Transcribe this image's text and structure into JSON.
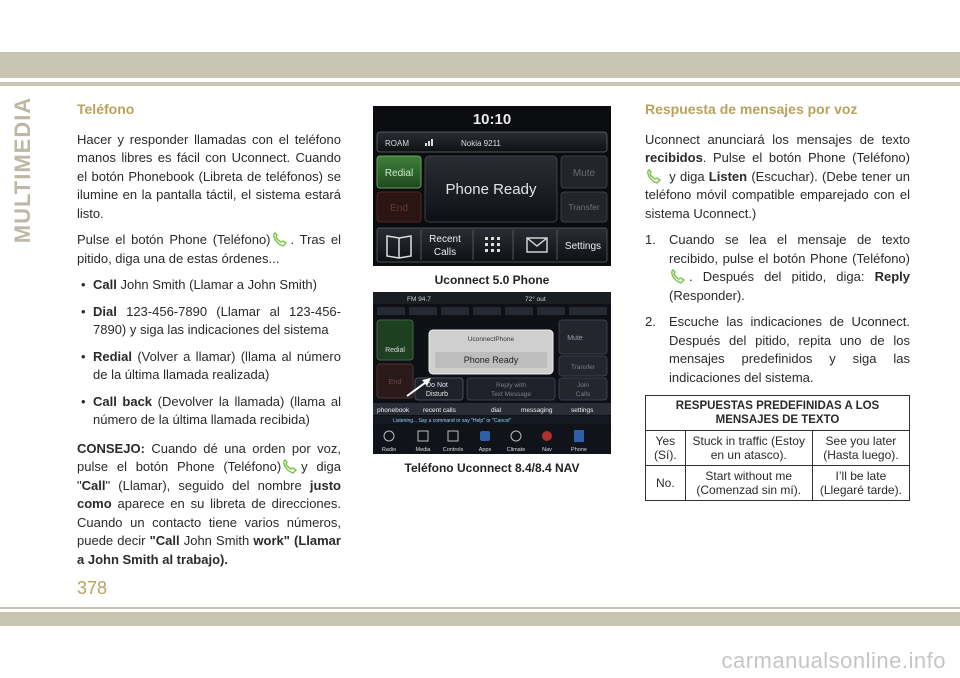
{
  "side_tab": "MULTIMEDIA",
  "left": {
    "heading": "Teléfono",
    "intro": "Hacer y responder llamadas con el teléfono manos libres es fácil con Uconnect. Cuando el botón Phonebook (Libreta de teléfonos) se ilumine en la pantalla táctil, el sistema estará listo.",
    "press_a": "Pulse el botón Phone (Teléfono)",
    "press_b": ". Tras el pitido, diga una de estas órdenes...",
    "bullets": [
      {
        "key": "Call",
        "text": "John Smith (Llamar a John Smith)"
      },
      {
        "key": "Dial",
        "text": "123-456-7890 (Llamar al 123-456-7890) y siga las indicaciones del sistema"
      },
      {
        "key": "Redial",
        "text": "(Volver a llamar) (llama al número de la última llamada realizada)"
      },
      {
        "key": "Call back",
        "text": "(Devolver la llamada) (llama al número de la última llamada recibida)"
      }
    ],
    "tip_label": "CONSEJO:",
    "tip_a": "Cuando dé una orden por voz, pulse el botón Phone (Teléfono)",
    "tip_b": "y diga \"",
    "tip_call": "Call",
    "tip_c": "\" (Llamar), seguido del nombre",
    "tip_justo": "justo como",
    "tip_d": "aparece en su libreta de direcciones. Cuando un contacto tiene varios números, puede decir",
    "tip_e": "\"Call",
    "tip_f": "John Smith",
    "tip_g": "work\" (Llamar a John Smith al trabajo)."
  },
  "screen1": {
    "time": "10:10",
    "roam": "ROAM",
    "carrier": "Nokia 9211",
    "redial": "Redial",
    "end": "End",
    "status": "Phone Ready",
    "mute": "Mute",
    "transfer": "Transfer",
    "recent1": "Recent",
    "recent2": "Calls",
    "settings": "Settings",
    "caption": "Uconnect 5.0 Phone"
  },
  "screen2": {
    "station": "FM 94.7",
    "temp": "72° out",
    "device": "UconnectPhone",
    "status": "Phone Ready",
    "redial": "Redial",
    "end": "End",
    "dnd1": "Do Not",
    "dnd2": "Disturb",
    "reply1": "Reply with",
    "reply2": "Text Message",
    "mute": "Mute",
    "transfer": "Transfer",
    "join1": "Join",
    "join2": "Calls",
    "tabs": [
      "phonebook",
      "recent calls",
      "dial",
      "messaging",
      "settings"
    ],
    "listening": "Listening... Say a command or say \"Help\" or \"Cancel\"",
    "bottom": [
      "Radio",
      "Media",
      "Controls",
      "Apps",
      "Climate",
      "Nav",
      "Phone"
    ],
    "caption": "Teléfono Uconnect 8.4/8.4 NAV"
  },
  "right": {
    "heading": "Respuesta de mensajes por voz",
    "p1_a": "Uconnect anunciará los mensajes de texto",
    "p1_recibidos": "recibidos",
    "p1_b": ". Pulse el botón Phone (Teléfono)",
    "p1_c": "y diga",
    "p1_listen": "Listen",
    "p1_d": "(Escuchar). (Debe tener un teléfono móvil compatible emparejado con el sistema Uconnect.)",
    "s1_n": "1.",
    "s1_a": "Cuando se lea el mensaje de texto recibido, pulse el botón Phone (Teléfono)",
    "s1_b": ". Después del pitido, diga:",
    "s1_reply": "Reply",
    "s1_c": "(Responder).",
    "s2_n": "2.",
    "s2": "Escuche las indicaciones de Uconnect. Después del pitido, repita uno de los mensajes predefinidos y siga las indicaciones del sistema.",
    "table_header": "RESPUESTAS PREDEFINIDAS A LOS MENSAJES DE TEXTO",
    "table_rows": [
      [
        "Yes (Sí).",
        "Stuck in traffic (Estoy en un atasco).",
        "See you later (Hasta luego)."
      ],
      [
        "No.",
        "Start without me (Comenzad sin mí).",
        "I’ll be late (Llegaré tarde)."
      ]
    ]
  },
  "page_number": "378",
  "watermark": "carmanualsonline.info",
  "colors": {
    "band": "#c9c3b1",
    "heading": "#b9a25e",
    "phone_icon": "#7dc142"
  }
}
